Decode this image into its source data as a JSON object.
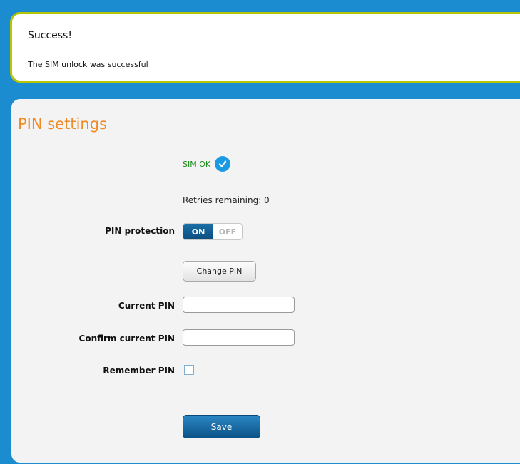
{
  "alert": {
    "title": "Success!",
    "message": "The SIM unlock was successful"
  },
  "pin_settings": {
    "title": "PIN settings",
    "sim_status": "SIM OK",
    "status_icon": "check-circle-icon",
    "retries": "Retries remaining: 0",
    "pin_protection_label": "PIN protection",
    "toggle_on": "ON",
    "toggle_off": "OFF",
    "toggle_state": "ON",
    "change_pin_label": "Change PIN",
    "current_pin_label": "Current PIN",
    "current_pin_value": "",
    "confirm_pin_label": "Confirm current PIN",
    "confirm_pin_value": "",
    "remember_pin_label": "Remember PIN",
    "remember_pin_checked": false,
    "save_label": "Save"
  },
  "colors": {
    "background": "#1a8ccf",
    "alert_border": "#b7c400",
    "title_orange": "#ef8a25",
    "ok_green": "#1a8a1a",
    "accent_blue": "#0c5388"
  }
}
